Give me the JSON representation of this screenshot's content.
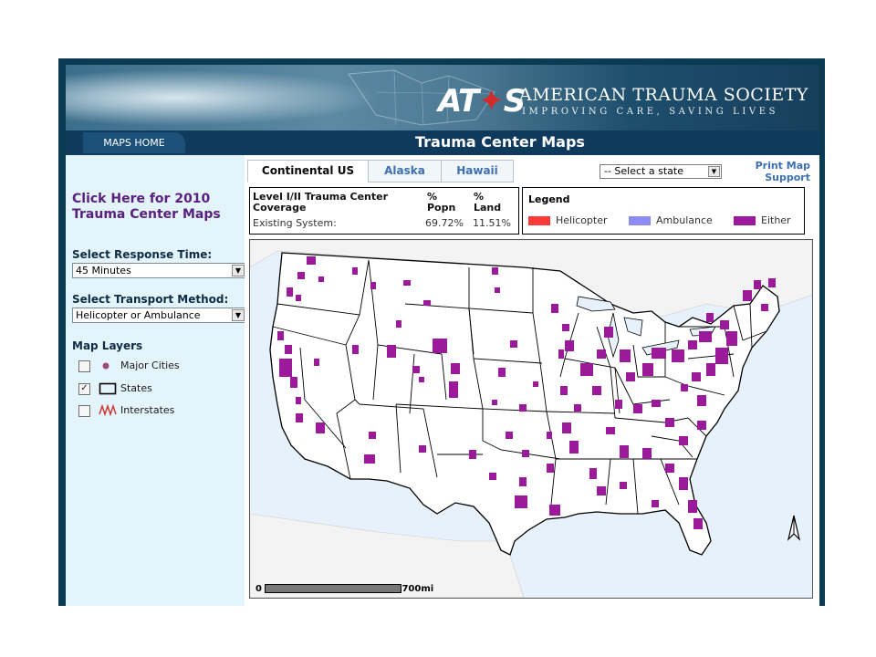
{
  "header": {
    "logo_text": "AT",
    "logo_end": "S",
    "org_name": "AMERICAN TRAUMA SOCIETY",
    "tagline": "IMPROVING CARE, SAVING LIVES",
    "maps_home": "MAPS HOME",
    "page_title": "Trauma Center Maps"
  },
  "sidebar": {
    "link_2010": "Click Here for 2010 Trauma Center Maps",
    "response_time_label": "Select Response Time:",
    "response_time_value": "45 Minutes",
    "transport_label": "Select Transport Method:",
    "transport_value": "Helicopter or Ambulance",
    "layers_label": "Map Layers",
    "layers": [
      {
        "label": "Major Cities",
        "checked": false,
        "icon": "city-dot-icon"
      },
      {
        "label": "States",
        "checked": true,
        "icon": "state-outline-icon"
      },
      {
        "label": "Interstates",
        "checked": false,
        "icon": "interstate-icon"
      }
    ]
  },
  "tabs": [
    {
      "label": "Continental US",
      "active": true
    },
    {
      "label": "Alaska",
      "active": false
    },
    {
      "label": "Hawaii",
      "active": false
    }
  ],
  "state_select": "-- Select a state",
  "links": {
    "print": "Print Map",
    "support": "Support"
  },
  "coverage": {
    "heading": "Level I/II Trauma Center Coverage",
    "popn_header": "% Popn",
    "land_header": "% Land",
    "row_label": "Existing System:",
    "popn_value": "69.72%",
    "land_value": "11.51%"
  },
  "legend": {
    "title": "Legend",
    "items": [
      {
        "label": "Helicopter",
        "color": "#ff3a3a"
      },
      {
        "label": "Ambulance",
        "color": "#8c8cf4"
      },
      {
        "label": "Either",
        "color": "#9b1a9b"
      }
    ]
  },
  "scale": {
    "start": "0",
    "end": "700mi"
  },
  "colors": {
    "frame": "#0b3b52",
    "sidebar": "#e3f4fb",
    "coverage_fill": "#9b1a9b",
    "water": "#e7f1fb"
  }
}
